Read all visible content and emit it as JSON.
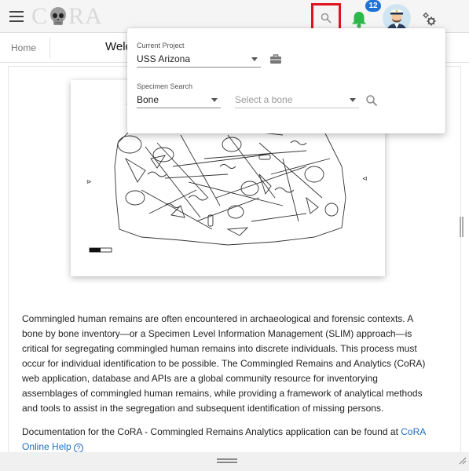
{
  "app": {
    "logo_text_left": "C",
    "logo_text_right": "RA",
    "notification_count": "12",
    "icons": {
      "menu": "menu-icon",
      "search": "search-icon",
      "bell": "bell-icon",
      "avatar": "avatar-icon",
      "settings": "gears-icon"
    },
    "colors": {
      "bell": "#2db84b",
      "badge": "#1e73d8",
      "highlight": "#e0141e",
      "link": "#1e6fc2"
    }
  },
  "nav": {
    "home": "Home",
    "title_partial": "Welco"
  },
  "popover": {
    "project_label": "Current Project",
    "project_value": "USS Arizona",
    "specimen_label": "Specimen Search",
    "specimen_type": "Bone",
    "bone_placeholder": "Select a bone"
  },
  "content": {
    "para1": "Commingled human remains are often encountered in archaeological and forensic contexts. A bone by bone inventory—or a Specimen Level Information Management (SLIM) approach—is critical for segregating commingled human remains into discrete individuals. This process must occur for individual identification to be possible. The Commingled Remains and Analytics (CoRA) web application, database and APIs are a global community resource for inventorying assemblages of commingled human remains, while providing a framework of analytical methods and tools to assist in the segregation and subsequent identification of missing persons.",
    "para2_prefix": "Documentation for the CoRA - Commingled Remains Analytics application can be found at ",
    "para2_link": "CoRA Online Help",
    "help_icon_text": "?"
  }
}
